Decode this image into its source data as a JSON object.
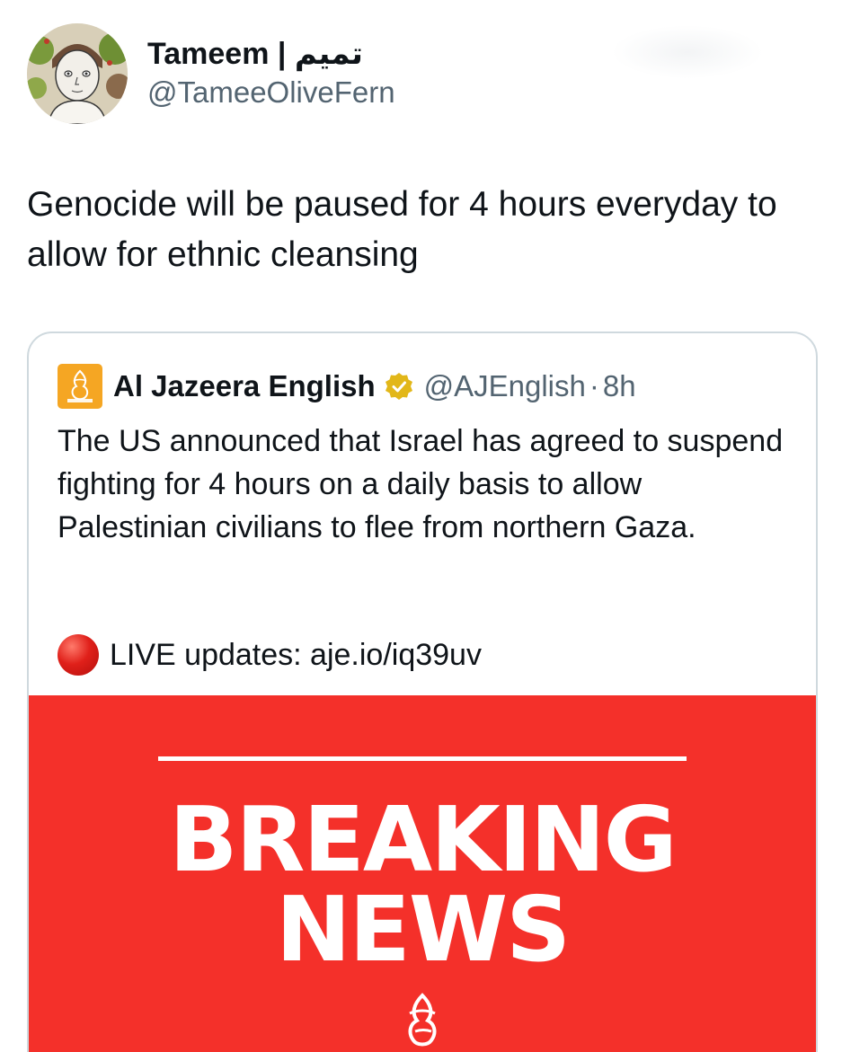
{
  "author": {
    "name": "Tameem | تميم",
    "handle": "@TameeOliveFern"
  },
  "tweet": {
    "text": "Genocide will be paused for 4 hours everyday to allow for ethnic cleansing"
  },
  "quoted_tweet": {
    "name": "Al Jazeera English",
    "handle": "@AJEnglish",
    "separator": "·",
    "time": "8h",
    "text": "The US announced that Israel has agreed to suspend fighting for 4 hours on a daily basis to allow Palestinian civilians to flee from northern Gaza.",
    "live_text": "LIVE updates: aje.io/iq39uv",
    "image": {
      "line1": "BREAKING",
      "line2": "NEWS",
      "background_color": "#f4302a"
    }
  },
  "colors": {
    "text_primary": "#0f1419",
    "text_secondary": "#536471",
    "border": "#cfd9de",
    "aj_orange": "#f5a623",
    "verified_gold": "#e2b719"
  },
  "icons": {
    "avatar": "avatar-illustration",
    "aj_logo": "al-jazeera-logo-icon",
    "verified": "verified-badge-icon",
    "live": "red-circle-icon"
  }
}
